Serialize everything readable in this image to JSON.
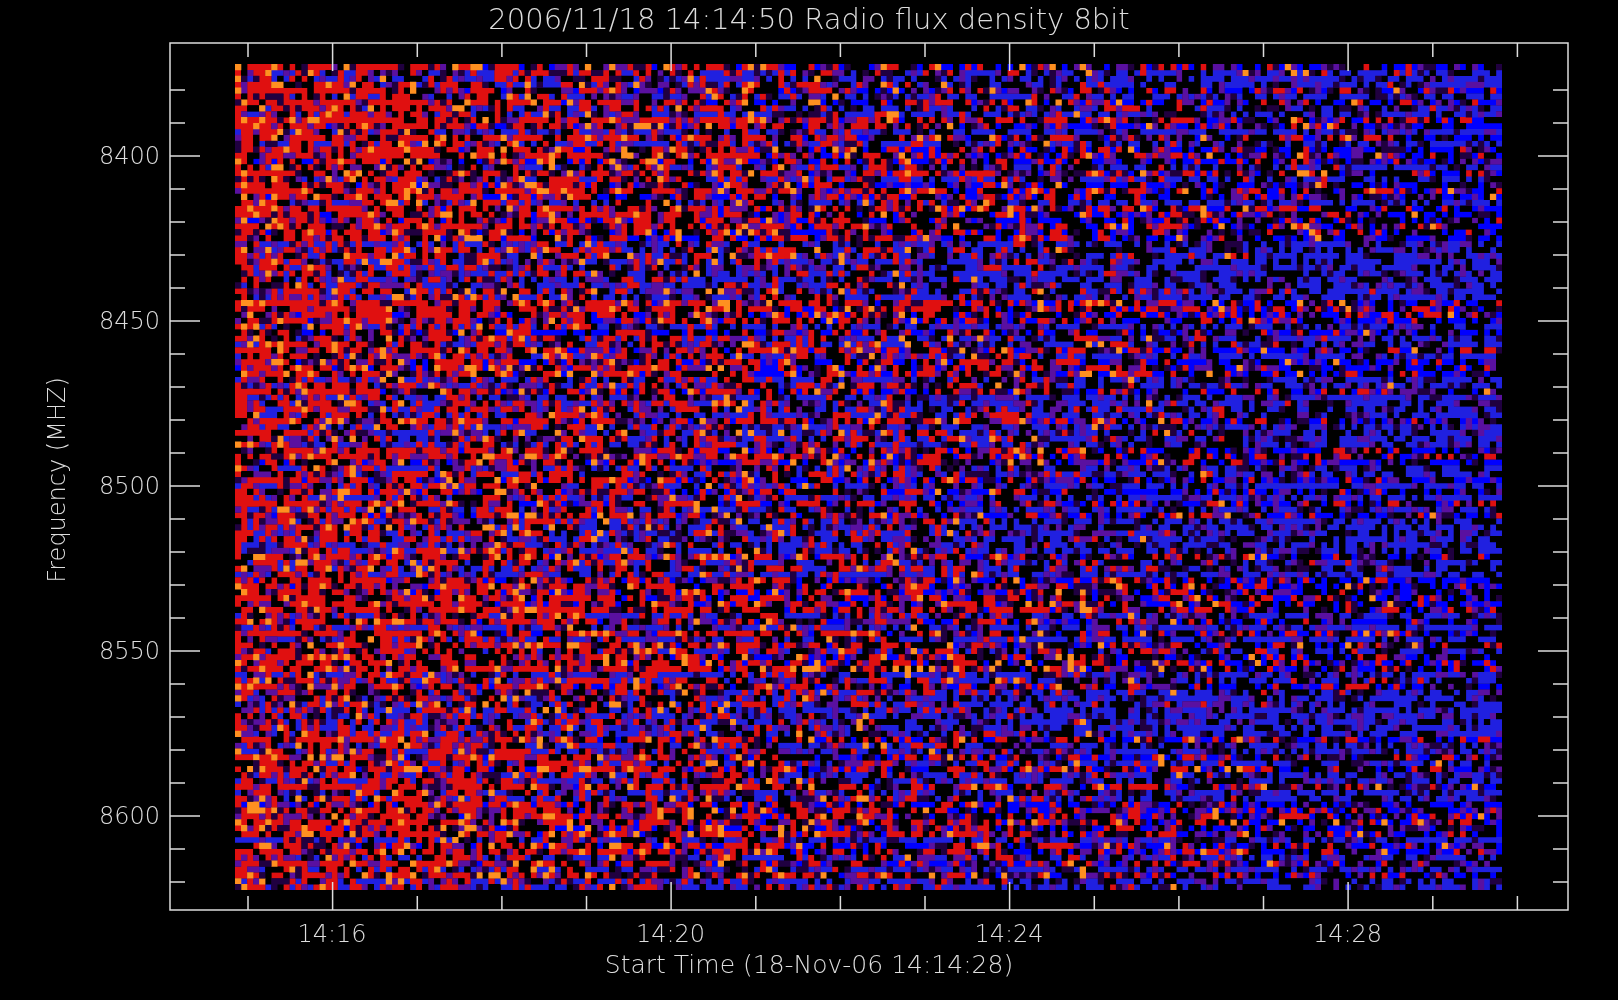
{
  "title": "2006/11/18 14:14:50 Radio flux density 8bit",
  "ylabel": "Frequency (MHZ)",
  "yticks": [
    "8400",
    "8450",
    "8500",
    "8550",
    "8600"
  ],
  "xticks": [
    "14:16",
    "14:20",
    "14:24",
    "14:28"
  ],
  "xlabel": "Start Time (18-Nov-06 14:14:28)"
}
